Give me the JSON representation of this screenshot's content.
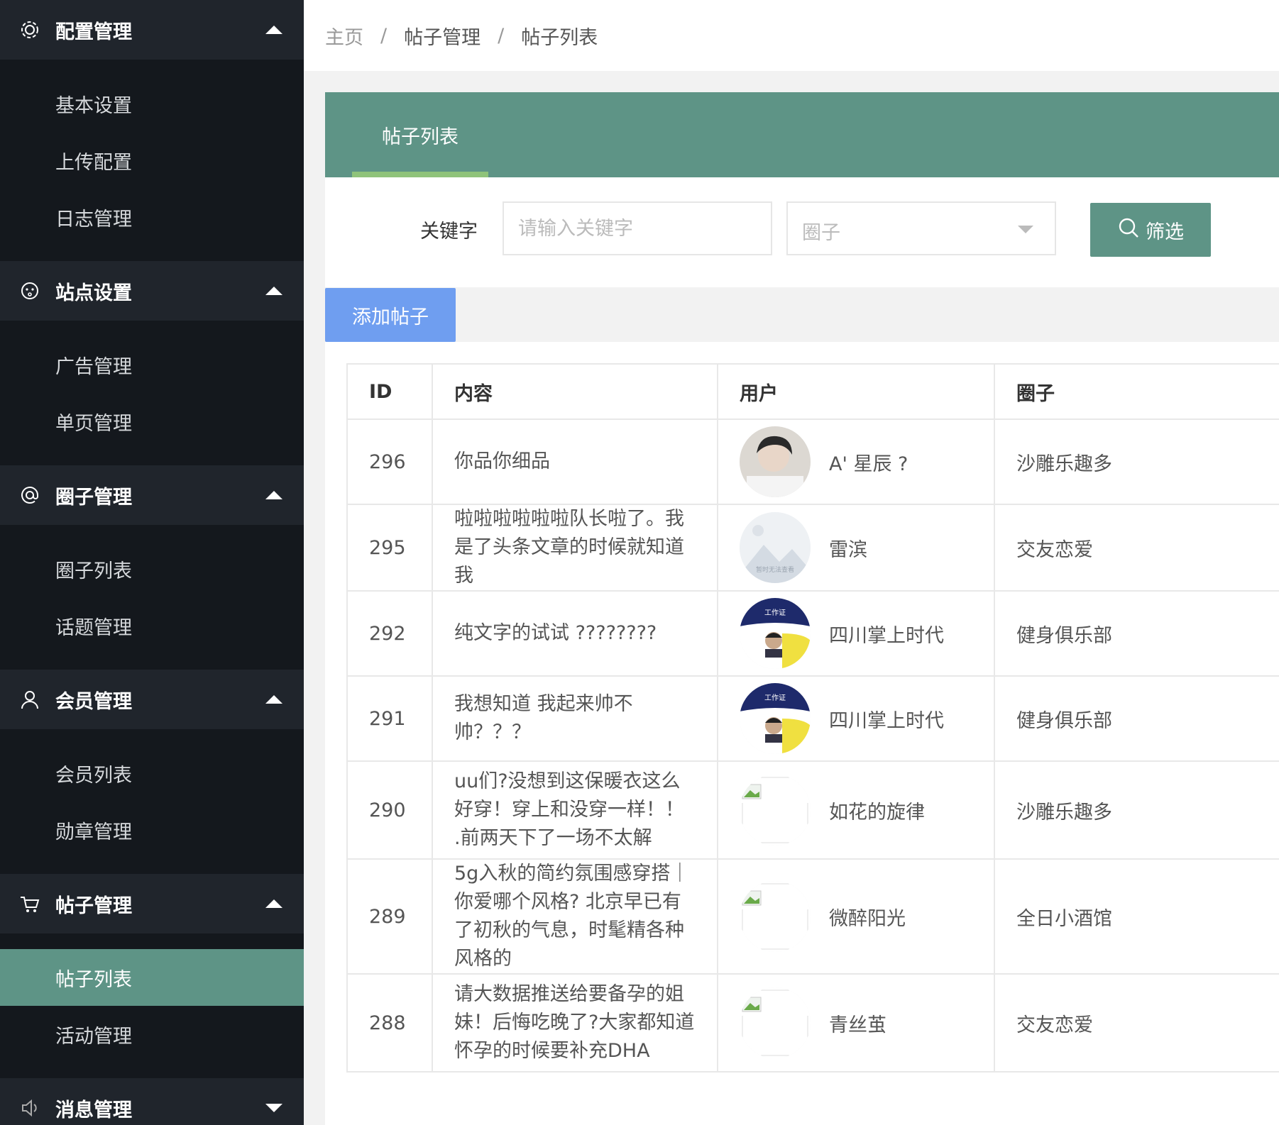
{
  "sidebar": {
    "groups": [
      {
        "title": "配置管理",
        "icon": "gear-icon",
        "items": [
          {
            "label": "基本设置"
          },
          {
            "label": "上传配置"
          },
          {
            "label": "日志管理"
          }
        ]
      },
      {
        "title": "站点设置",
        "icon": "face-icon",
        "items": [
          {
            "label": "广告管理"
          },
          {
            "label": "单页管理"
          }
        ]
      },
      {
        "title": "圈子管理",
        "icon": "at-icon",
        "items": [
          {
            "label": "圈子列表"
          },
          {
            "label": "话题管理"
          }
        ]
      },
      {
        "title": "会员管理",
        "icon": "user-icon",
        "items": [
          {
            "label": "会员列表"
          },
          {
            "label": "勋章管理"
          }
        ]
      },
      {
        "title": "帖子管理",
        "icon": "cart-icon",
        "items": [
          {
            "label": "帖子列表",
            "active": true
          },
          {
            "label": "活动管理"
          }
        ]
      },
      {
        "title": "消息管理",
        "icon": "speaker-icon",
        "items": []
      }
    ]
  },
  "breadcrumb": {
    "home": "主页",
    "sep": "/",
    "level1": "帖子管理",
    "current": "帖子列表"
  },
  "panel": {
    "tab": "帖子列表"
  },
  "filter": {
    "keyword_label": "关键字",
    "keyword_placeholder": "请输入关键字",
    "circle_placeholder": "圈子",
    "filter_button": "筛选"
  },
  "actions": {
    "add_post": "添加帖子"
  },
  "table": {
    "headers": {
      "id": "ID",
      "content": "内容",
      "user": "用户",
      "circle": "圈子"
    },
    "rows": [
      {
        "id": "296",
        "content": "你品你细品",
        "user": "A' 星辰 ?",
        "circle": "沙雕乐趣多",
        "avatar": "photo"
      },
      {
        "id": "295",
        "content": "啦啦啦啦啦啦队长啦了。我是了头条文章的时候就知道我",
        "user": "雷滨",
        "circle": "交友恋爱",
        "avatar": "placeholder",
        "avatar_caption": "暂时无法查看"
      },
      {
        "id": "292",
        "content": "纯文字的试试 ????????",
        "user": "四川掌上时代",
        "circle": "健身俱乐部",
        "avatar": "badge",
        "avatar_caption": "工作证"
      },
      {
        "id": "291",
        "content": "我想知道 我起来帅不帅？？？",
        "user": "四川掌上时代",
        "circle": "健身俱乐部",
        "avatar": "badge",
        "avatar_caption": "工作证"
      },
      {
        "id": "290",
        "content": "uu们?没想到这保暖衣这么好穿！穿上和没穿一样！！ .前两天下了一场不太解",
        "user": "如花的旋律",
        "circle": "沙雕乐趣多",
        "avatar": "broken"
      },
      {
        "id": "289",
        "content": "5g入秋的简约氛围感穿搭｜你爱哪个风格? 北京早已有了初秋的气息，时髦精各种风格的",
        "user": "微醉阳光",
        "circle": "全日小酒馆",
        "avatar": "broken"
      },
      {
        "id": "288",
        "content": "请大数据推送给要备孕的姐妹！后悔吃晚了?大家都知道怀孕的时候要补充DHA",
        "user": "青丝茧",
        "circle": "交友恋爱",
        "avatar": "broken"
      }
    ]
  }
}
